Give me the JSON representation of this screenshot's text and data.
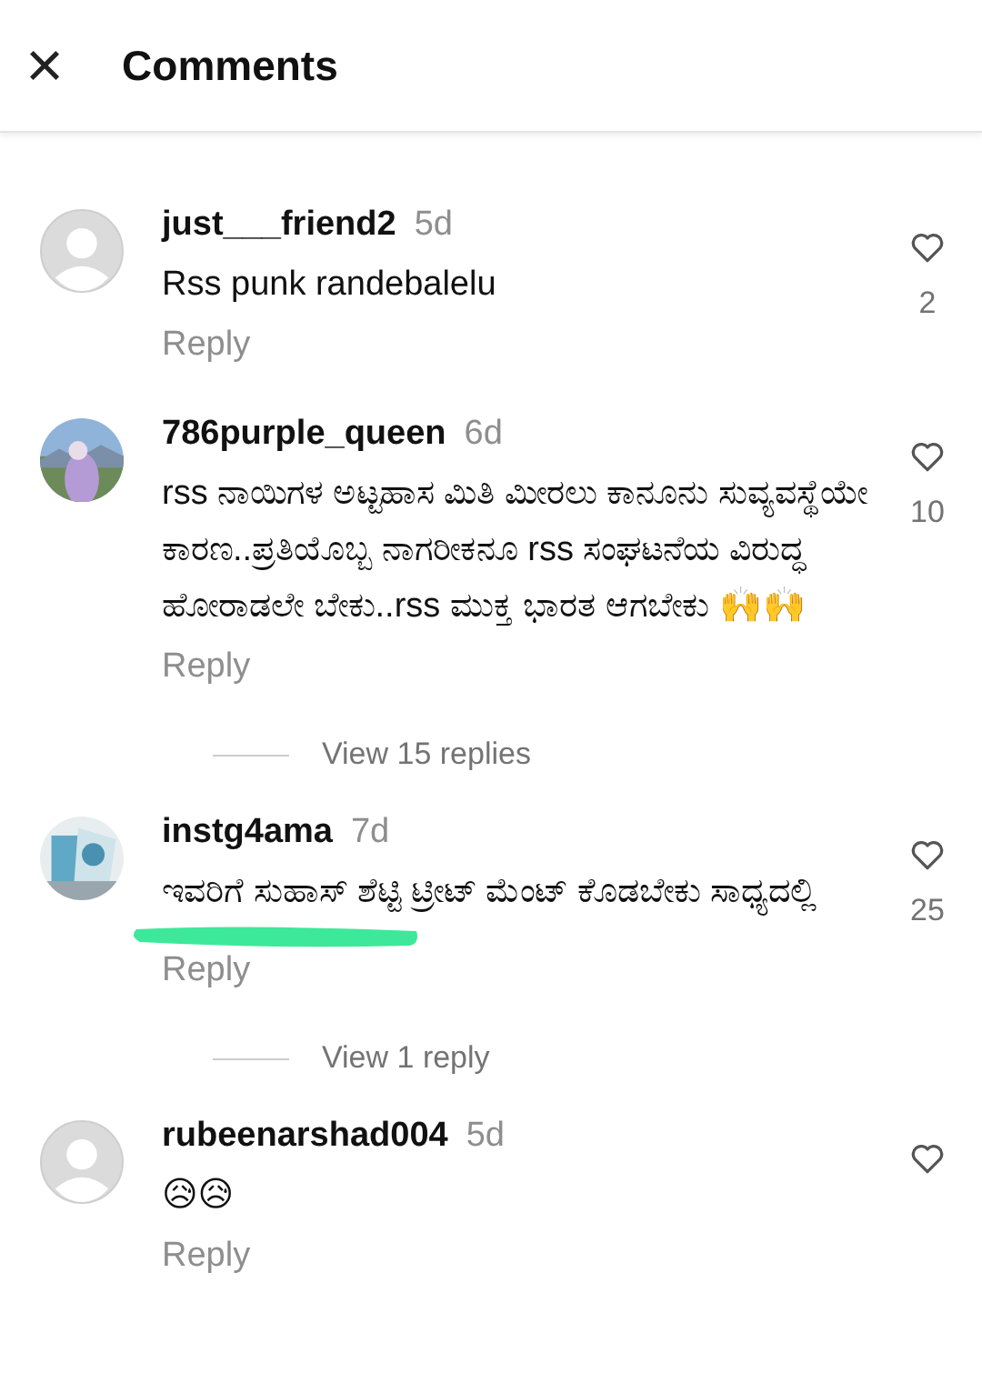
{
  "header": {
    "close_icon": "×",
    "title": "Comments"
  },
  "comments": [
    {
      "avatar": {
        "kind": "default"
      },
      "username": "just___friend2",
      "time": "5d",
      "text": "Rss punk randebalelu",
      "likes": "2",
      "reply": "Reply",
      "highlighted": false
    },
    {
      "username": "786purple_queen",
      "time": "6d",
      "text": "rss ನಾಯಿಗಳ ಅಟ್ಟಹಾಸ ಮಿತಿ ಮೀರಲು ಕಾನೂನು ಸುವ್ಯವಸ್ಥೆಯೇ ಕಾರಣ..ಪ್ರತಿಯೊಬ್ಬ ನಾಗರೀಕನೂ rss ಸಂಘಟನೆಯ ವಿರುದ್ಧ ಹೋರಾಡಲೇ ಬೇಕು..rss ಮುಕ್ತ ಭಾರತ ಆಗಬೇಕು 🙌🙌",
      "likes": "10",
      "reply": "Reply",
      "highlighted": false,
      "view_replies": "View 15 replies"
    },
    {
      "username": "instg4ama",
      "time": "7d",
      "text": "ಇವರಿಗೆ ಸುಹಾಸ್ ಶೆಟ್ಟಿ ಟ್ರೀಟ್ ಮೆಂಟ್ ಕೊಡಬೇಕು ಸಾಧ್ಯದಲ್ಲಿ",
      "likes": "25",
      "reply": "Reply",
      "highlighted": true,
      "view_replies": "View 1 reply"
    },
    {
      "avatar": {
        "kind": "default"
      },
      "username": "rubeenarshad004",
      "time": "5d",
      "text": "😥😥",
      "reply": "Reply",
      "highlighted": false
    }
  ]
}
